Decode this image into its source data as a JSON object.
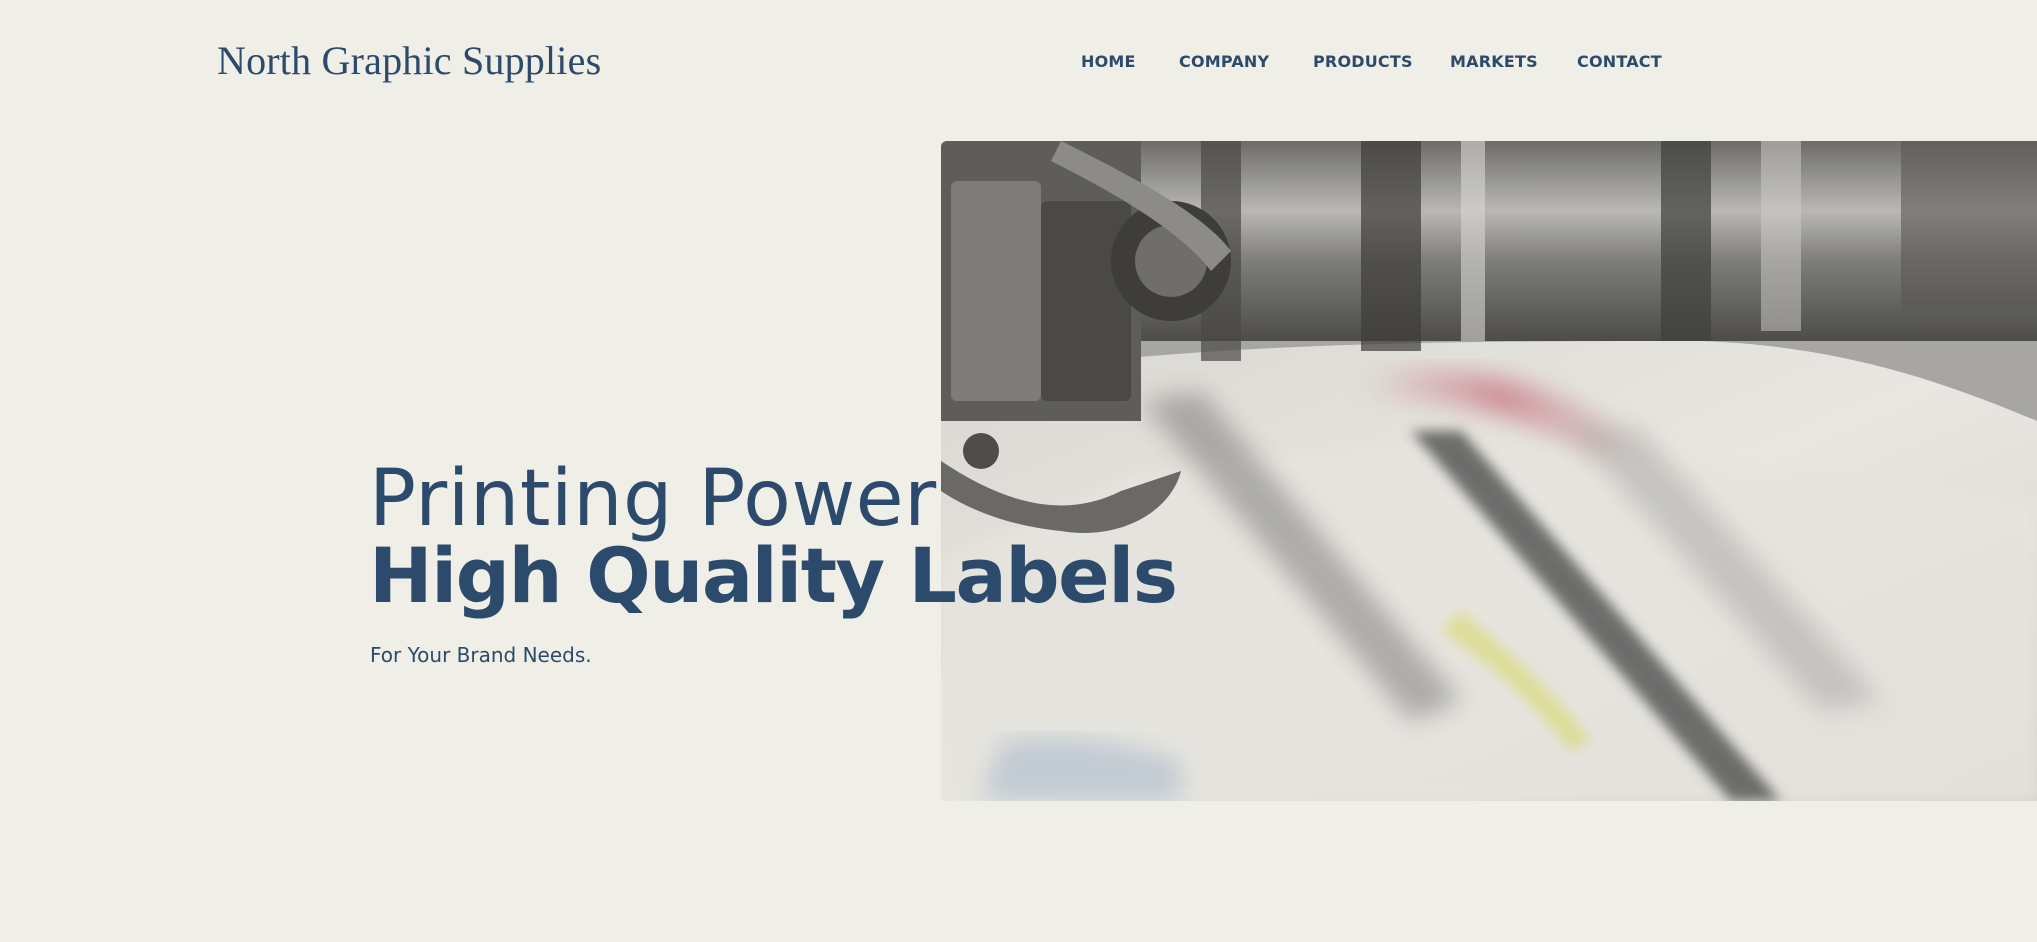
{
  "header": {
    "logo_text": "North Graphic Supplies",
    "nav": [
      {
        "label": "HOME"
      },
      {
        "label": "COMPANY"
      },
      {
        "label": "PRODUCTS"
      },
      {
        "label": "MARKETS"
      },
      {
        "label": "CONTACT"
      }
    ]
  },
  "hero": {
    "line1": "Printing Power",
    "line2": "High Quality Labels",
    "subtitle": "For Your Brand Needs."
  },
  "colors": {
    "background": "#efeee7",
    "brand_text": "#2c4a6b"
  }
}
